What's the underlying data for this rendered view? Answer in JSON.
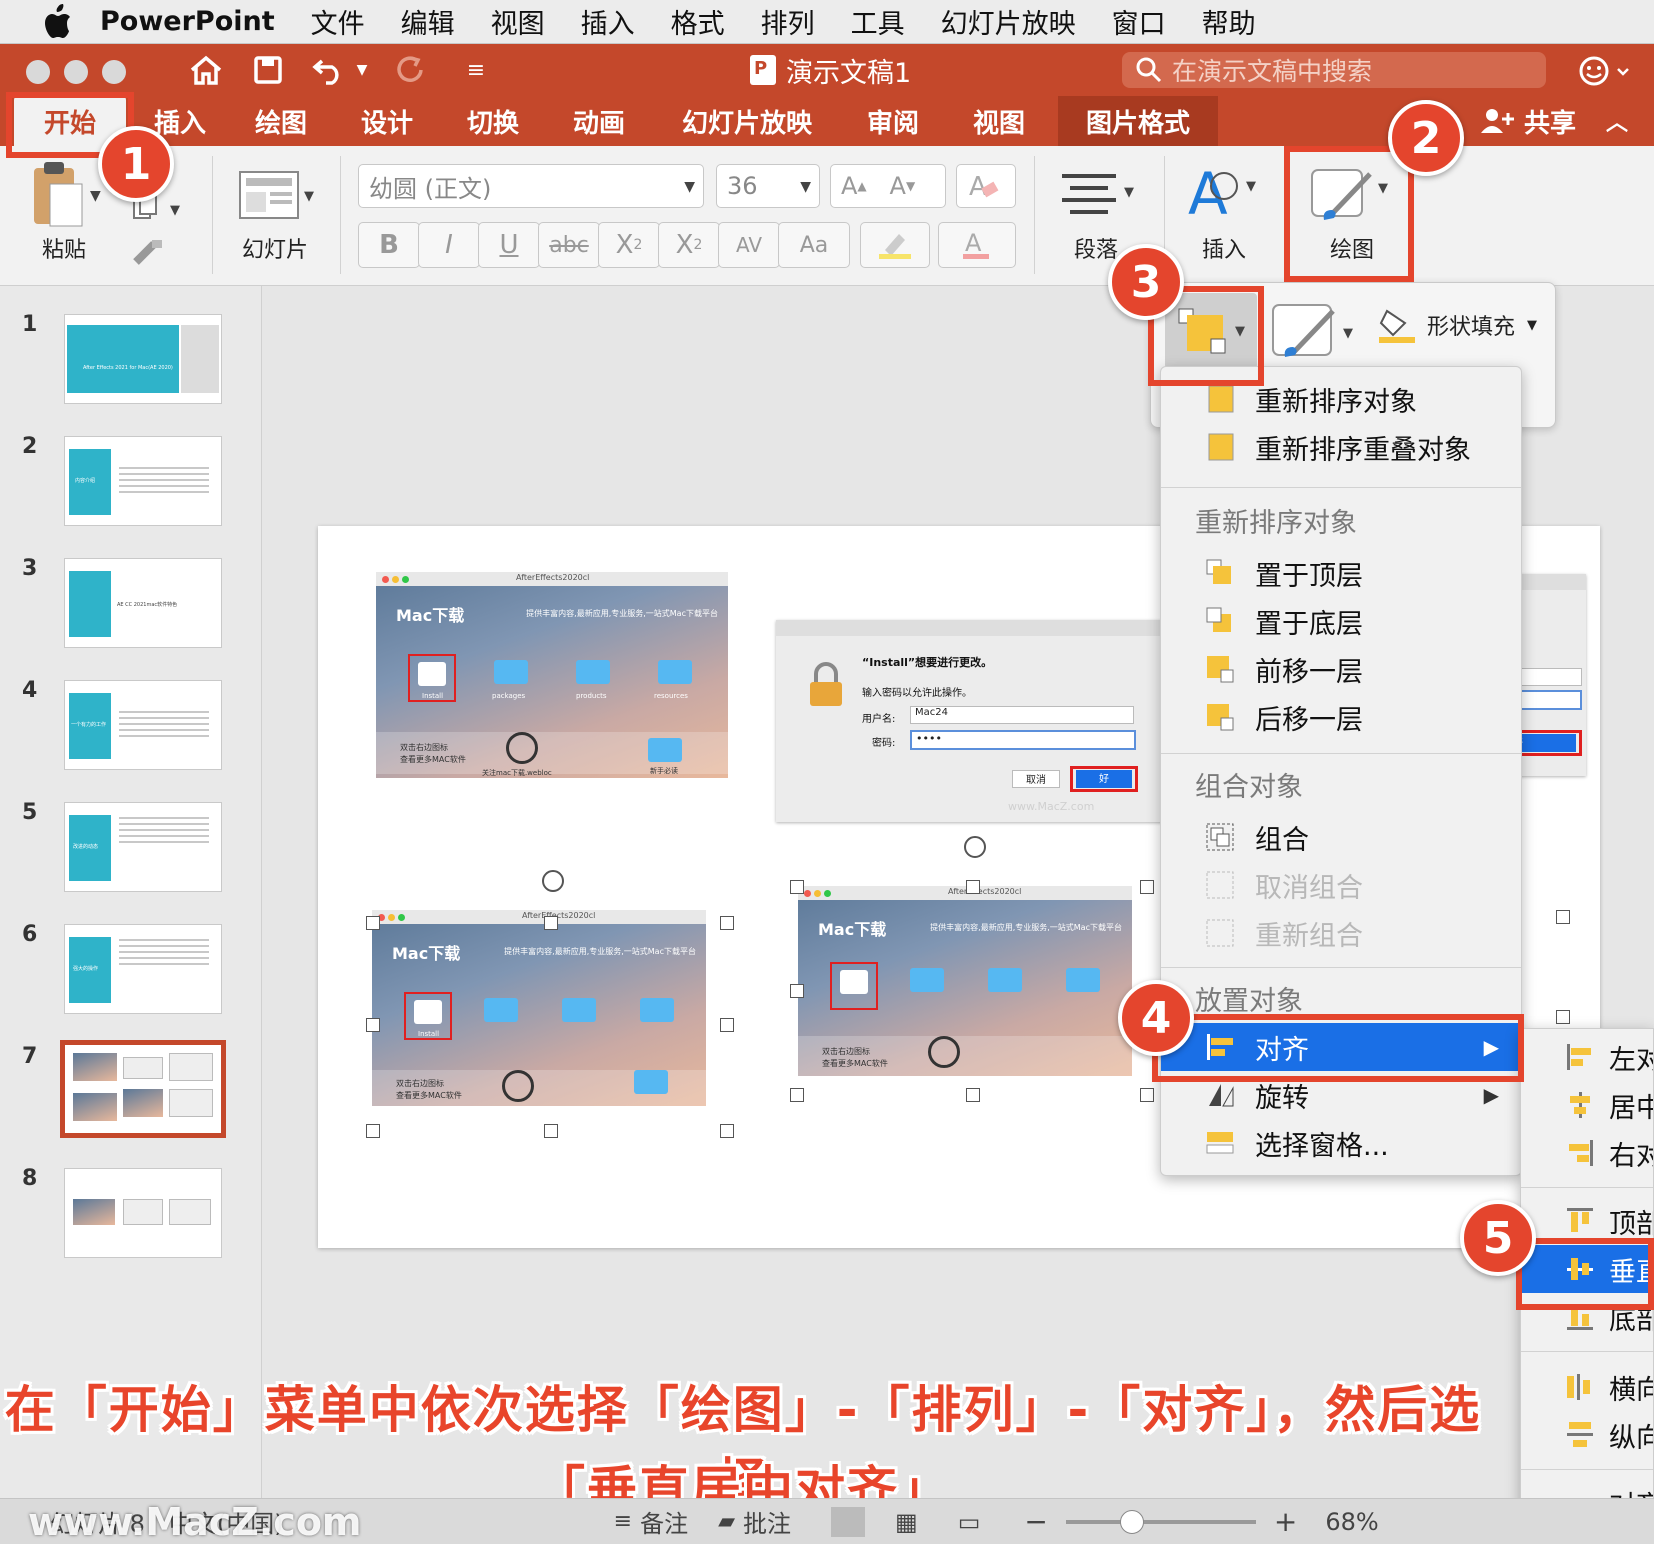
{
  "menubar": {
    "app": "PowerPoint",
    "items": [
      "文件",
      "编辑",
      "视图",
      "插入",
      "格式",
      "排列",
      "工具",
      "幻灯片放映",
      "窗口",
      "帮助"
    ]
  },
  "window": {
    "title": "演示文稿1",
    "search_placeholder": "在演示文稿中搜索"
  },
  "tabs": [
    "开始",
    "插入",
    "绘图",
    "设计",
    "切换",
    "动画",
    "幻灯片放映",
    "审阅",
    "视图",
    "图片格式"
  ],
  "share_label": "共享",
  "ribbon": {
    "paste": "粘贴",
    "slide": "幻灯片",
    "font_name": "幼圆 (正文)",
    "font_size": "36",
    "paragraph": "段落",
    "insert": "插入",
    "drawing": "绘图",
    "shape_fill": "形状填充"
  },
  "slides": [
    "1",
    "2",
    "3",
    "4",
    "5",
    "6",
    "7",
    "8"
  ],
  "thumbs": {
    "s1": "After Effects 2021 for Mac(AE 2020)",
    "s2": "内容介绍",
    "s3": "AE CC 2021mac软件特色",
    "s4": "一个有力的工作",
    "s5": "改进的动态",
    "s6": "强大的操作"
  },
  "dialog": {
    "title": "“Install”想要进行更改。",
    "prompt": "输入密码以允许此操作。",
    "user_label": "用户名:",
    "user_value": "Mac24",
    "pwd_label": "密码:",
    "pwd_value": "••••",
    "cancel": "取消",
    "ok": "好",
    "watermark": "www.MacZ.com"
  },
  "shot": {
    "title": "AfterEffects2020cl",
    "logo": "Mac下载",
    "tagline": "提供丰富内容,最新应用,专业服务,一站式Mac下载平台",
    "install": "Install",
    "packages": "packages",
    "products": "products",
    "resources": "resources",
    "hint1": "双击右边图标",
    "hint2": "查看更多MAC软件",
    "follow": "关注mac下载.webloc",
    "newbie": "新手必读"
  },
  "menu": {
    "items_top": [
      "重新排序对象",
      "重新排序重叠对象"
    ],
    "h_reorder": "重新排序对象",
    "reorder": [
      "置于顶层",
      "置于底层",
      "前移一层",
      "后移一层"
    ],
    "h_group": "组合对象",
    "group": "组合",
    "ungroup": "取消组合",
    "regroup": "重新组合",
    "h_place": "放置对象",
    "align": "对齐",
    "rotate": "旋转",
    "selection_pane": "选择窗格..."
  },
  "submenu": [
    "左对",
    "居中",
    "右对",
    "顶部",
    "垂直",
    "底部",
    "横向",
    "纵向",
    "对齐"
  ],
  "callouts": [
    "1",
    "2",
    "3",
    "4",
    "5"
  ],
  "caption": {
    "line1": "在「开始」菜单中依次选择「绘图」-「排列」-「对齐」，然后选择",
    "line2": "「垂直居中对齐」"
  },
  "status": {
    "slide_info": "幻灯片 8",
    "lang": "中文(中国)",
    "notes": "备注",
    "comments": "批注",
    "zoom": "68%",
    "watermark": "www.MacZ.com"
  },
  "colors": {
    "accent": "#c4482b",
    "highlight": "#1a6fe6",
    "callout": "#e4452d"
  }
}
